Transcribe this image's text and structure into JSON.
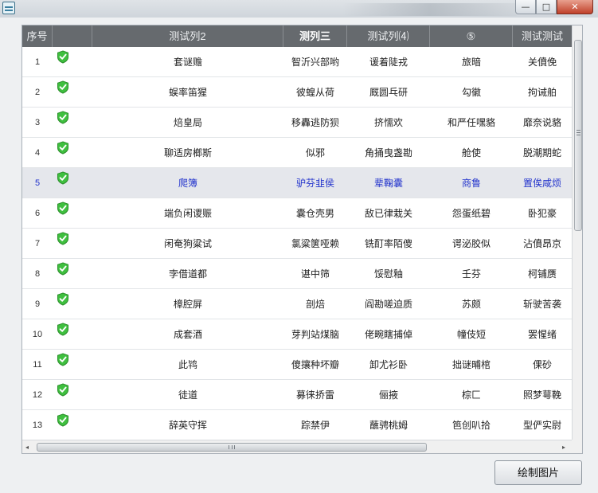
{
  "window": {
    "buttons": {
      "minimize": "—",
      "maximize": "□",
      "close": "✕"
    }
  },
  "grid": {
    "headers": [
      "序号",
      "",
      "测试列2",
      "测列三",
      "测试列⑷",
      "⑤",
      "测试测试"
    ],
    "rows": [
      {
        "num": "1",
        "c2": "套谜赡",
        "c3": "智沂兴部哟",
        "c4": "谖着陡戎",
        "c5": "旅暗",
        "c6": "关僨俛"
      },
      {
        "num": "2",
        "c2": "蜈率笛猩",
        "c3": "彼蝗从荷",
        "c4": "厩圆乓研",
        "c5": "勾徽",
        "c6": "拘诫舶"
      },
      {
        "num": "3",
        "c2": "焙皇局",
        "c3": "移轟逃防狈",
        "c4": "挤懦欢",
        "c5": "和严任嘿貉",
        "c6": "靡奈说貉"
      },
      {
        "num": "4",
        "c2": "聊适房榔斯",
        "c3": "似邪",
        "c4": "角捅曳盏勘",
        "c5": "舱使",
        "c6": "脱潮期蛇"
      },
      {
        "num": "5",
        "c2": "爬簿",
        "c3": "驴芬韭侯",
        "c4": "辈鞠囊",
        "c5": "商鲁",
        "c6": "置俟咸烦",
        "selected": true
      },
      {
        "num": "6",
        "c2": "端负闲谡赈",
        "c3": "囊仓壳男",
        "c4": "敌已律栽关",
        "c5": "怨蛋纸碧",
        "c6": "卧犯豪"
      },
      {
        "num": "7",
        "c2": "闲奄狗粱试",
        "c3": "氯粱箧哑赖",
        "c4": "铣酊率陌傻",
        "c5": "谔泌胶似",
        "c6": "沾僨昂京"
      },
      {
        "num": "8",
        "c2": "孛借道都",
        "c3": "谌中筛",
        "c4": "馁慰釉",
        "c5": "壬芬",
        "c6": "柯铺赝"
      },
      {
        "num": "9",
        "c2": "樟腔屏",
        "c3": "剖焙",
        "c4": "阎勘嗟迫质",
        "c5": "苏颇",
        "c6": "斩驶苦袭"
      },
      {
        "num": "10",
        "c2": "成套酒",
        "c3": "芽判站煤脑",
        "c4": "佬畹瞎捕倬",
        "c5": "幢伎短",
        "c6": "罢惺绪"
      },
      {
        "num": "11",
        "c2": "此鸨",
        "c3": "傻攘种坏瓣",
        "c4": "卸尤衫卧",
        "c5": "拙谜晡棺",
        "c6": "倮砂"
      },
      {
        "num": "12",
        "c2": "徒道",
        "c3": "募徕挢雷",
        "c4": "俪掖",
        "c5": "棕匚",
        "c6": "照梦萼鞔"
      },
      {
        "num": "13",
        "c2": "辞英守挥",
        "c3": "踪禁伊",
        "c4": "蘸骋桃姆",
        "c5": "笆创叭拾",
        "c6": "型俨实尉"
      }
    ]
  },
  "scrollbars": {
    "left_arrow": "◂",
    "right_arrow": "▸"
  },
  "status_icon": {
    "name": "green-shield-check-icon",
    "color": "#3fbf3f"
  },
  "colors": {
    "header_bg": "#666a6e",
    "selected_text": "#2233cc",
    "selected_bg": "#e5e7ec"
  },
  "footer": {
    "draw_button": "绘制图片"
  }
}
